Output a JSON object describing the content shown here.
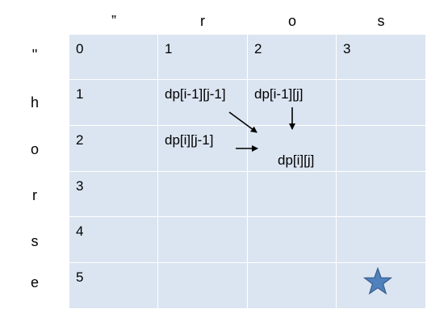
{
  "col_headers": [
    "”",
    "r",
    "o",
    "s"
  ],
  "row_headers": [
    "''",
    "h",
    "o",
    "r",
    "s",
    "e"
  ],
  "cells": [
    [
      "0",
      "1",
      "2",
      "3"
    ],
    [
      "1",
      "",
      "",
      ""
    ],
    [
      "2",
      "",
      "",
      ""
    ],
    [
      "3",
      "",
      "",
      ""
    ],
    [
      "4",
      "",
      "",
      ""
    ],
    [
      "5",
      "",
      "",
      ""
    ]
  ],
  "labels": {
    "top_left": "dp[i-1][j-1]",
    "top": "dp[i-1][j]",
    "left": "dp[i][j-1]",
    "current": "dp[i][j]"
  },
  "colors": {
    "grid_fill": "#dbe5f1",
    "grid_line": "#ffffff",
    "star_fill": "#4f81bd",
    "star_stroke": "#385d8a"
  },
  "icons": {
    "target": "star-icon"
  }
}
